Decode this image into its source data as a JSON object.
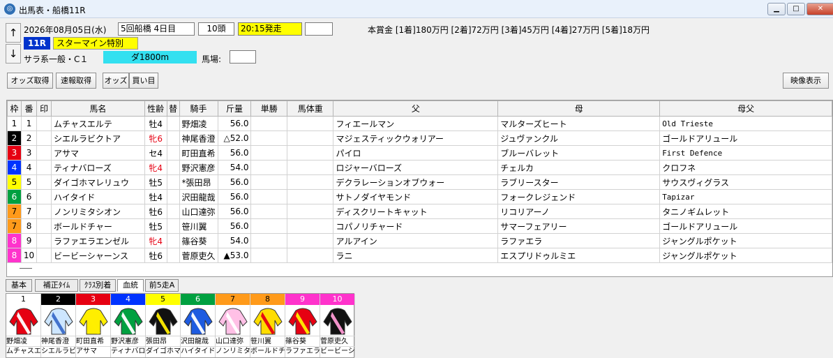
{
  "window": {
    "title": "出馬表・船橋11R"
  },
  "header": {
    "date": "2026年08月05日(水)",
    "meeting": "5回船橋 4日目",
    "heads": "10頭",
    "post_time": "20:15発走",
    "race_no": "11R",
    "race_name": "スターマイン特別",
    "race_class": "サラ系一般・C１",
    "course": "ダ1800m",
    "going_label": "馬場:",
    "going_value": "",
    "prize": "本賞金 [1着]180万円 [2着]72万円 [3着]45万円 [4着]27万円 [5着]18万円",
    "up": "↑",
    "down": "↓"
  },
  "toolbar": {
    "odds_fetch": "オッズ取得",
    "sokuho_fetch": "速報取得",
    "odds": "オッズ",
    "kaime": "買い目",
    "video": "映像表示"
  },
  "columns": [
    "枠",
    "番",
    "印",
    "馬名",
    "性齢",
    "替",
    "騎手",
    "斤量",
    "単勝",
    "馬体重",
    "父",
    "母",
    "母父"
  ],
  "waku_colors": {
    "1": {
      "bg": "#ffffff",
      "fg": "#000000"
    },
    "2": {
      "bg": "#000000",
      "fg": "#ffffff"
    },
    "3": {
      "bg": "#e60012",
      "fg": "#ffffff"
    },
    "4": {
      "bg": "#0033ff",
      "fg": "#ffffff"
    },
    "5": {
      "bg": "#ffff00",
      "fg": "#000000"
    },
    "6": {
      "bg": "#00a040",
      "fg": "#ffffff"
    },
    "7": {
      "bg": "#ff9a1a",
      "fg": "#000000"
    },
    "8": {
      "bg": "#ff33cc",
      "fg": "#ffffff"
    }
  },
  "horses": [
    {
      "waku": "1",
      "num": "1",
      "mark": "",
      "name": "ムチャスエルテ",
      "sex_age": "牡4",
      "filly": false,
      "change": "",
      "jockey": "野畑凌",
      "weight": "56.0",
      "odds": "",
      "body": "",
      "sire": "フィエールマン",
      "dam": "マルターズヒート",
      "damsire": "Old Trieste"
    },
    {
      "waku": "2",
      "num": "2",
      "mark": "",
      "name": "シエルラビクトア",
      "sex_age": "牝6",
      "filly": true,
      "change": "",
      "jockey": "神尾香澄",
      "weight": "△52.0",
      "odds": "",
      "body": "",
      "sire": "マジェスティックウォリアー",
      "dam": "ジュヴァンクル",
      "damsire": "ゴールドアリュール"
    },
    {
      "waku": "3",
      "num": "3",
      "mark": "",
      "name": "アサマ",
      "sex_age": "セ4",
      "filly": false,
      "change": "",
      "jockey": "町田直希",
      "weight": "56.0",
      "odds": "",
      "body": "",
      "sire": "パイロ",
      "dam": "ブルーバレット",
      "damsire": "First Defence"
    },
    {
      "waku": "4",
      "num": "4",
      "mark": "",
      "name": "ティナバローズ",
      "sex_age": "牝4",
      "filly": true,
      "change": "",
      "jockey": "野沢憲彦",
      "weight": "54.0",
      "odds": "",
      "body": "",
      "sire": "ロジャーバローズ",
      "dam": "チェルカ",
      "damsire": "クロフネ"
    },
    {
      "waku": "5",
      "num": "5",
      "mark": "",
      "name": "ダイゴホマレリュウ",
      "sex_age": "牡5",
      "filly": false,
      "change": "",
      "jockey": "*張田昂",
      "weight": "56.0",
      "odds": "",
      "body": "",
      "sire": "デクラレーションオブウォー",
      "dam": "ラブリースター",
      "damsire": "サウスヴィグラス"
    },
    {
      "waku": "6",
      "num": "6",
      "mark": "",
      "name": "ハイタイド",
      "sex_age": "牡4",
      "filly": false,
      "change": "",
      "jockey": "沢田龍哉",
      "weight": "56.0",
      "odds": "",
      "body": "",
      "sire": "サトノダイヤモンド",
      "dam": "フォークレジェンド",
      "damsire": "Tapizar"
    },
    {
      "waku": "7",
      "num": "7",
      "mark": "",
      "name": "ノンリミタシオン",
      "sex_age": "牡6",
      "filly": false,
      "change": "",
      "jockey": "山口達弥",
      "weight": "56.0",
      "odds": "",
      "body": "",
      "sire": "ディスクリートキャット",
      "dam": "リコリアーノ",
      "damsire": "タニノギムレット"
    },
    {
      "waku": "7",
      "num": "8",
      "mark": "",
      "name": "ボールドチャー",
      "sex_age": "牡5",
      "filly": false,
      "change": "",
      "jockey": "笹川翼",
      "weight": "56.0",
      "odds": "",
      "body": "",
      "sire": "コパノリチャード",
      "dam": "サマーフェアリー",
      "damsire": "ゴールドアリュール"
    },
    {
      "waku": "8",
      "num": "9",
      "mark": "",
      "name": "ラファエラエンゼル",
      "sex_age": "牝4",
      "filly": true,
      "change": "",
      "jockey": "篠谷葵",
      "weight": "54.0",
      "odds": "",
      "body": "",
      "sire": "アルアイン",
      "dam": "ラファエラ",
      "damsire": "ジャングルポケット"
    },
    {
      "waku": "8",
      "num": "10",
      "mark": "",
      "name": "ビービーシャーンス",
      "sex_age": "牡6",
      "filly": false,
      "change": "",
      "jockey": "菅原吏久",
      "weight": "▲53.0",
      "odds": "",
      "body": "",
      "sire": "ラニ",
      "dam": "エスプリドゥルミエ",
      "damsire": "ジャングルポケット"
    }
  ],
  "tabs": [
    "基本",
    "補正ﾀｲﾑ",
    "ｸﾗｽ別着",
    "血統",
    "前5走A"
  ],
  "active_tab": "血統",
  "silks": [
    {
      "num": "1",
      "jockey": "野畑凌",
      "horse": "ムチャスエ"
    },
    {
      "num": "2",
      "jockey": "神尾香澄",
      "horse": "シエルラビ"
    },
    {
      "num": "3",
      "jockey": "町田直希",
      "horse": "アサマ"
    },
    {
      "num": "4",
      "jockey": "野沢憲彦",
      "horse": "ティナバロ"
    },
    {
      "num": "5",
      "jockey": "張田昂",
      "horse": "ダイゴホマ"
    },
    {
      "num": "6",
      "jockey": "沢田龍哉",
      "horse": "ハイタイド"
    },
    {
      "num": "7",
      "jockey": "山口達弥",
      "horse": "ノンリミタ"
    },
    {
      "num": "8",
      "jockey": "笹川翼",
      "horse": "ボールドチ"
    },
    {
      "num": "9",
      "jockey": "篠谷葵",
      "horse": "ラファエラ"
    },
    {
      "num": "10",
      "jockey": "菅原吏久",
      "horse": "ビービーシ"
    }
  ]
}
